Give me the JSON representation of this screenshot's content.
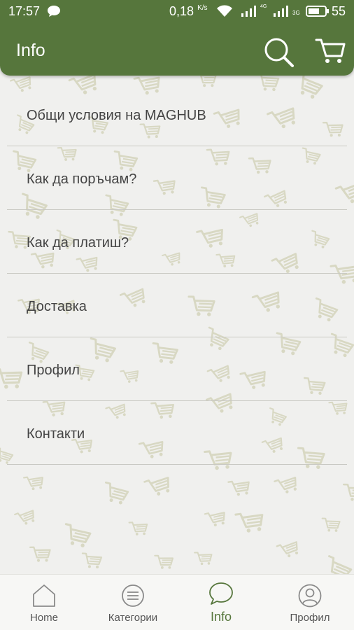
{
  "status_bar": {
    "time": "17:57",
    "speed": "0,18",
    "speed_unit": "K/s",
    "net1": "4G",
    "net2": "3G",
    "battery": "55"
  },
  "app_bar": {
    "title": "Info",
    "search_icon": "search-icon",
    "cart_icon": "cart-icon"
  },
  "menu": {
    "items": [
      {
        "label": "Общи условия на MAGHUB"
      },
      {
        "label": "Как да поръчам?"
      },
      {
        "label": "Как да платиш?"
      },
      {
        "label": "Доставка"
      },
      {
        "label": "Профил"
      },
      {
        "label": "Контакти"
      }
    ]
  },
  "bottom_nav": {
    "items": [
      {
        "label": "Home",
        "icon": "home-icon"
      },
      {
        "label": "Категории",
        "icon": "categories-icon"
      },
      {
        "label": "Info",
        "icon": "chat-bubble-icon",
        "active": true
      },
      {
        "label": "Профил",
        "icon": "user-icon"
      }
    ]
  },
  "colors": {
    "primary": "#56763c",
    "background": "#f0f0ee",
    "pattern": "#dcdcc8",
    "text": "#444444"
  }
}
